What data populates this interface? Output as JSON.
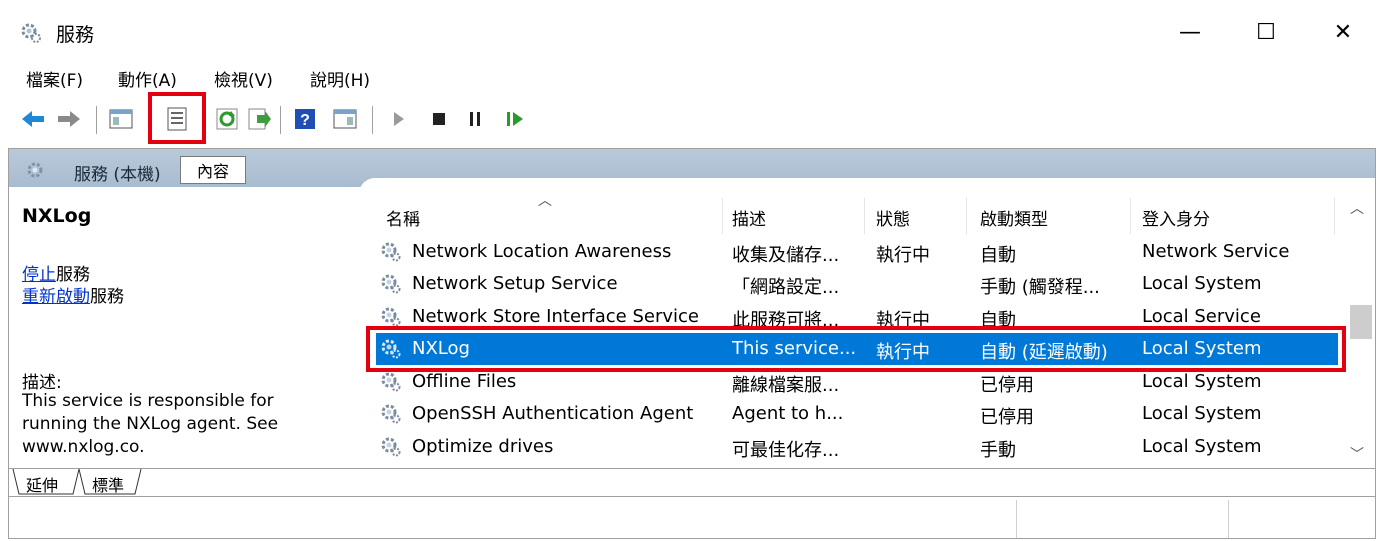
{
  "window": {
    "title": "服務",
    "min_glyph": "—",
    "max_glyph": "☐",
    "close_glyph": "✕"
  },
  "menu": [
    "檔案(F)",
    "動作(A)",
    "檢視(V)",
    "說明(H)"
  ],
  "toolbar": {
    "icons": [
      "back-arrow-icon",
      "forward-arrow-icon",
      "show-hide-console-tree-icon",
      "properties-icon",
      "refresh-icon",
      "export-list-icon",
      "help-icon",
      "show-hide-action-pane-icon",
      "start-service-icon",
      "stop-service-icon",
      "pause-service-icon",
      "resume-service-icon"
    ],
    "highlighted": "properties-icon"
  },
  "scope": {
    "title": "服務 (本機)",
    "tooltip": "內容"
  },
  "details": {
    "service_name": "NXLog",
    "stop_link": "停止",
    "stop_suffix": "服務",
    "restart_link": "重新啟動",
    "restart_suffix": "服務",
    "desc_label": "描述:",
    "desc_text": "This service is responsible for running the NXLog agent. See www.nxlog.co."
  },
  "columns": [
    "名稱",
    "描述",
    "狀態",
    "啟動類型",
    "登入身分"
  ],
  "rows": [
    {
      "name": "Network Location Awareness",
      "desc": "收集及儲存...",
      "status": "執行中",
      "startup": "自動",
      "logon": "Network Service"
    },
    {
      "name": "Network Setup Service",
      "desc": "「網路設定...",
      "status": "",
      "startup": "手動 (觸發程...",
      "logon": "Local System"
    },
    {
      "name": "Network Store Interface Service",
      "desc": "此服務可將...",
      "status": "執行中",
      "startup": "自動",
      "logon": "Local Service"
    },
    {
      "name": "NXLog",
      "desc": "This service...",
      "status": "執行中",
      "startup": "自動 (延遲啟動)",
      "logon": "Local System",
      "selected": true
    },
    {
      "name": "Offline Files",
      "desc": "離線檔案服...",
      "status": "",
      "startup": "已停用",
      "logon": "Local System"
    },
    {
      "name": "OpenSSH Authentication Agent",
      "desc": "Agent to h...",
      "status": "",
      "startup": "已停用",
      "logon": "Local System"
    },
    {
      "name": "Optimize drives",
      "desc": "可最佳化存...",
      "status": "",
      "startup": "手動",
      "logon": "Local System"
    }
  ],
  "bottom_tabs": [
    "延伸",
    "標準"
  ],
  "colors": {
    "selection": "#0078d7",
    "highlight_box": "#e3000f",
    "scope_bar": "#b0c3d6",
    "link": "#0033cc"
  }
}
